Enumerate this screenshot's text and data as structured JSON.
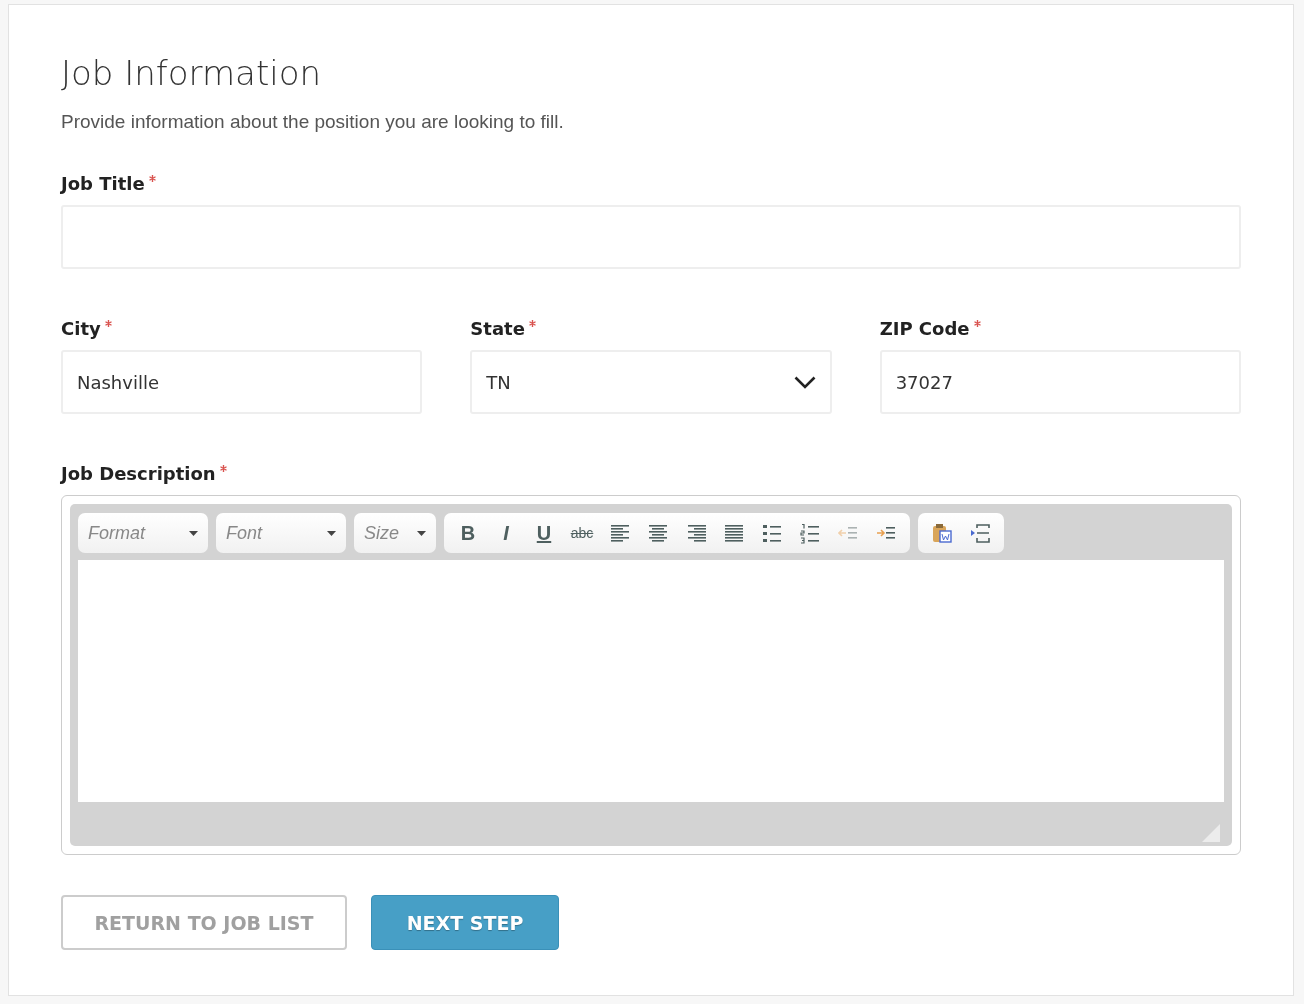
{
  "heading": "Job Information",
  "intro": "Provide information about the position you are looking to fill.",
  "job_title": {
    "label": "Job Title",
    "required": true
  },
  "location_fields": [
    {
      "kind": "text",
      "label": "City",
      "required": true,
      "value": "Nashville"
    },
    {
      "kind": "select",
      "label": "State",
      "required": true,
      "value": "TN"
    },
    {
      "kind": "text",
      "label": "ZIP Code",
      "required": true,
      "value": "37027"
    }
  ],
  "description": {
    "label": "Job Description",
    "required": true,
    "combos": [
      {
        "placeholder": "Format"
      },
      {
        "placeholder": "Font"
      },
      {
        "placeholder": "Size"
      }
    ],
    "toolbar_groups": [
      [
        {
          "kind": "bold",
          "label": "B",
          "disabled": false
        },
        {
          "kind": "italic",
          "label": "I",
          "disabled": false
        },
        {
          "kind": "underline",
          "label": "U",
          "disabled": false
        },
        {
          "kind": "strike",
          "label": "abc",
          "disabled": false
        },
        {
          "kind": "align-left",
          "disabled": false
        },
        {
          "kind": "align-center",
          "disabled": false
        },
        {
          "kind": "align-right",
          "disabled": false
        },
        {
          "kind": "justify",
          "disabled": false
        },
        {
          "kind": "bullet-list",
          "disabled": false
        },
        {
          "kind": "numbered-list",
          "disabled": false
        },
        {
          "kind": "outdent",
          "disabled": true
        },
        {
          "kind": "indent",
          "disabled": false
        }
      ],
      [
        {
          "kind": "paste-word",
          "disabled": false
        },
        {
          "kind": "page-break",
          "disabled": false
        }
      ]
    ]
  },
  "buttons": [
    {
      "kind": "secondary",
      "label": "RETURN TO JOB LIST"
    },
    {
      "kind": "primary",
      "label": "NEXT STEP"
    }
  ]
}
